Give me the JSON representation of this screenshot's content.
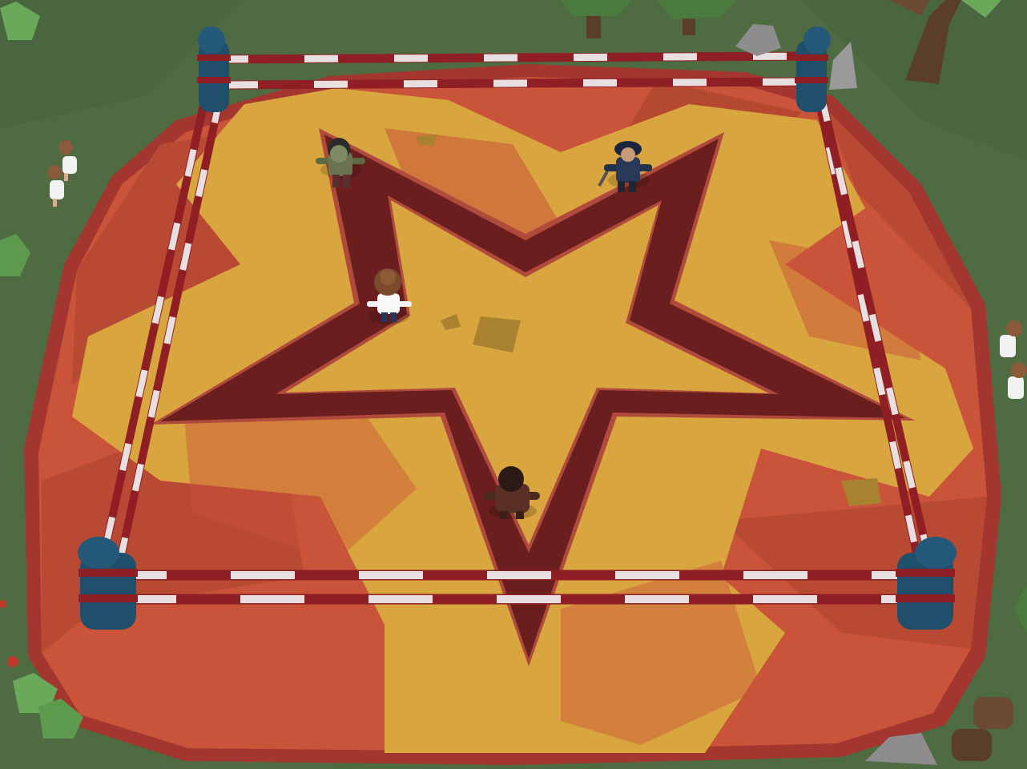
{
  "scene": {
    "title": "",
    "colors": {
      "grass": "#4f6b41",
      "grass_dark": "#465f3a",
      "arena_rim": "#a3362f",
      "arena_orange": "#c9543a",
      "arena_orange_dark": "#b5492f",
      "arena_yellow": "#d9a53e",
      "star_dark": "#6a1f1e",
      "star_outline": "#b04a3c",
      "rope_red": "#8f1f24",
      "rope_white": "#e8e0e0",
      "post_blue": "#1f4f6a",
      "rock": "#8d8d8d",
      "tree_leaf": "#5a9a4c",
      "tree_trunk": "#5a3d2b"
    },
    "ring_posts": [
      "top-left",
      "top-right",
      "bottom-left",
      "bottom-right"
    ],
    "characters": [
      {
        "id": "zombie",
        "kind": "enemy"
      },
      {
        "id": "police-officer",
        "kind": "enemy"
      },
      {
        "id": "brown-haired-fighter",
        "kind": "player"
      },
      {
        "id": "bald-brute",
        "kind": "enemy"
      }
    ],
    "spectators": [
      {
        "id": "spectator-left-1"
      },
      {
        "id": "spectator-left-2"
      },
      {
        "id": "spectator-right-1"
      },
      {
        "id": "spectator-right-2"
      }
    ],
    "icons": [
      "tree-icon",
      "rock-icon",
      "bush-icon",
      "mushroom-icon",
      "stump-icon"
    ]
  }
}
